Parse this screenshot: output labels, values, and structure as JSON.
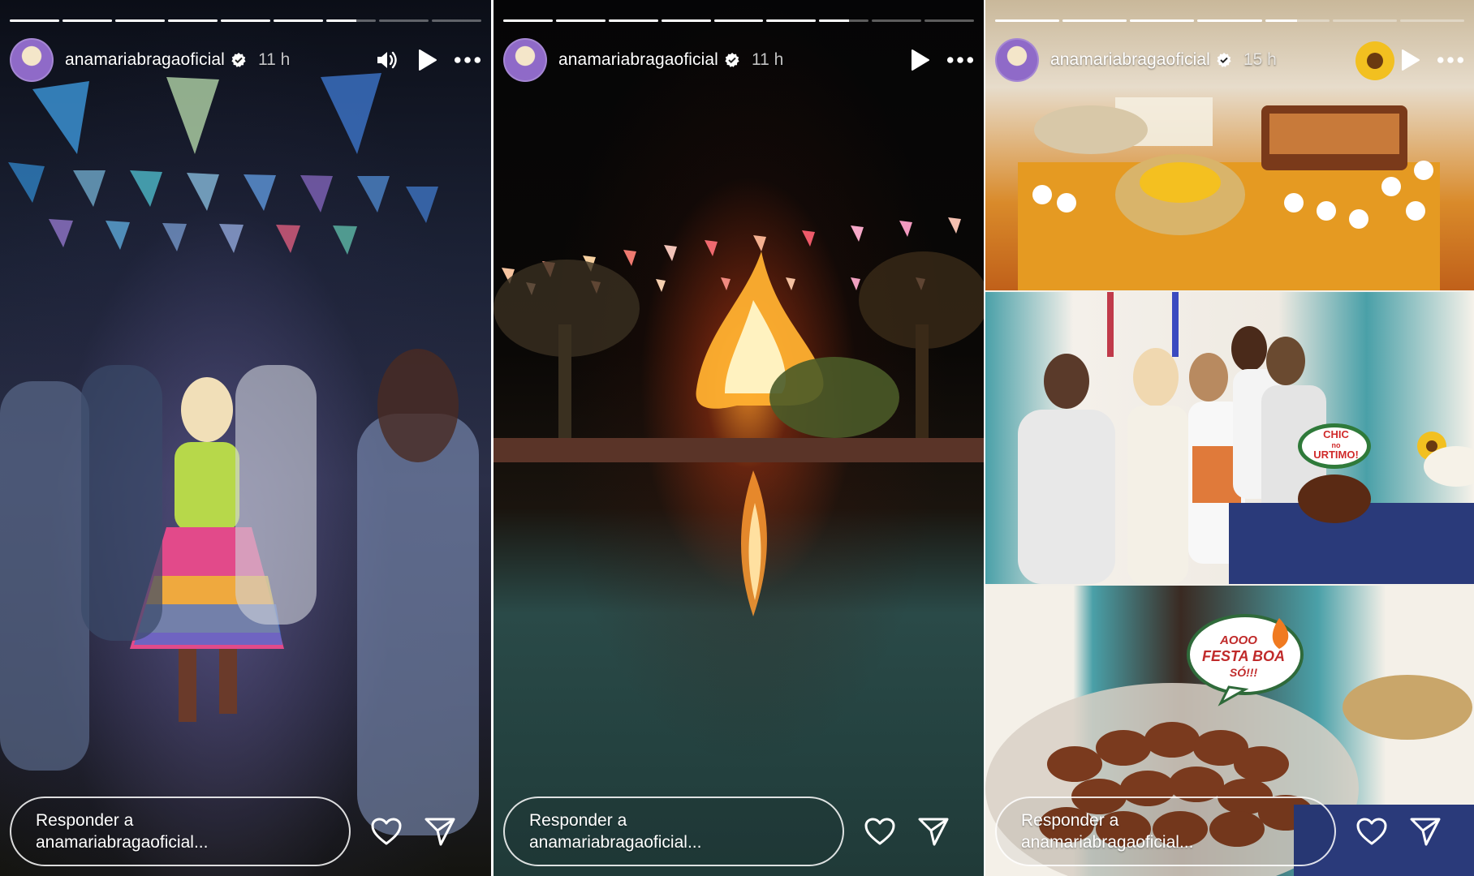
{
  "stories": [
    {
      "username": "anamariabragaoficial",
      "time": "11 h",
      "reply_placeholder_line1": "Responder a",
      "reply_placeholder_line2": "anamariabragaoficial...",
      "progress": [
        1,
        1,
        1,
        1,
        1,
        1,
        0.6,
        0,
        0
      ],
      "has_sound": true
    },
    {
      "username": "anamariabragaoficial",
      "time": "11 h",
      "reply_placeholder_line1": "Responder a",
      "reply_placeholder_line2": "anamariabragaoficial...",
      "progress": [
        1,
        1,
        1,
        1,
        1,
        1,
        0.6,
        0,
        0
      ],
      "has_sound": false
    },
    {
      "username": "anamariabragaoficial",
      "time": "15 h",
      "reply_placeholder_line1": "Responder a",
      "reply_placeholder_line2": "anamariabragaoficial...",
      "progress": [
        1,
        1,
        1,
        1,
        0.5,
        0,
        0
      ],
      "has_sound": false,
      "stickers": {
        "chic_line1": "CHIC",
        "chic_line2": "no",
        "chic_line3": "URTIMO!",
        "festa_line1": "AOOO",
        "festa_line2": "FESTA BOA",
        "festa_line3": "SÓ!!!"
      }
    }
  ],
  "icons": {
    "verified": "verified-badge-icon",
    "sound": "speaker-icon",
    "play": "play-icon",
    "more": "more-options-icon",
    "like": "heart-icon",
    "share": "send-icon"
  },
  "colors": {
    "verified": "#ffffff",
    "accent": "#ffffff"
  }
}
